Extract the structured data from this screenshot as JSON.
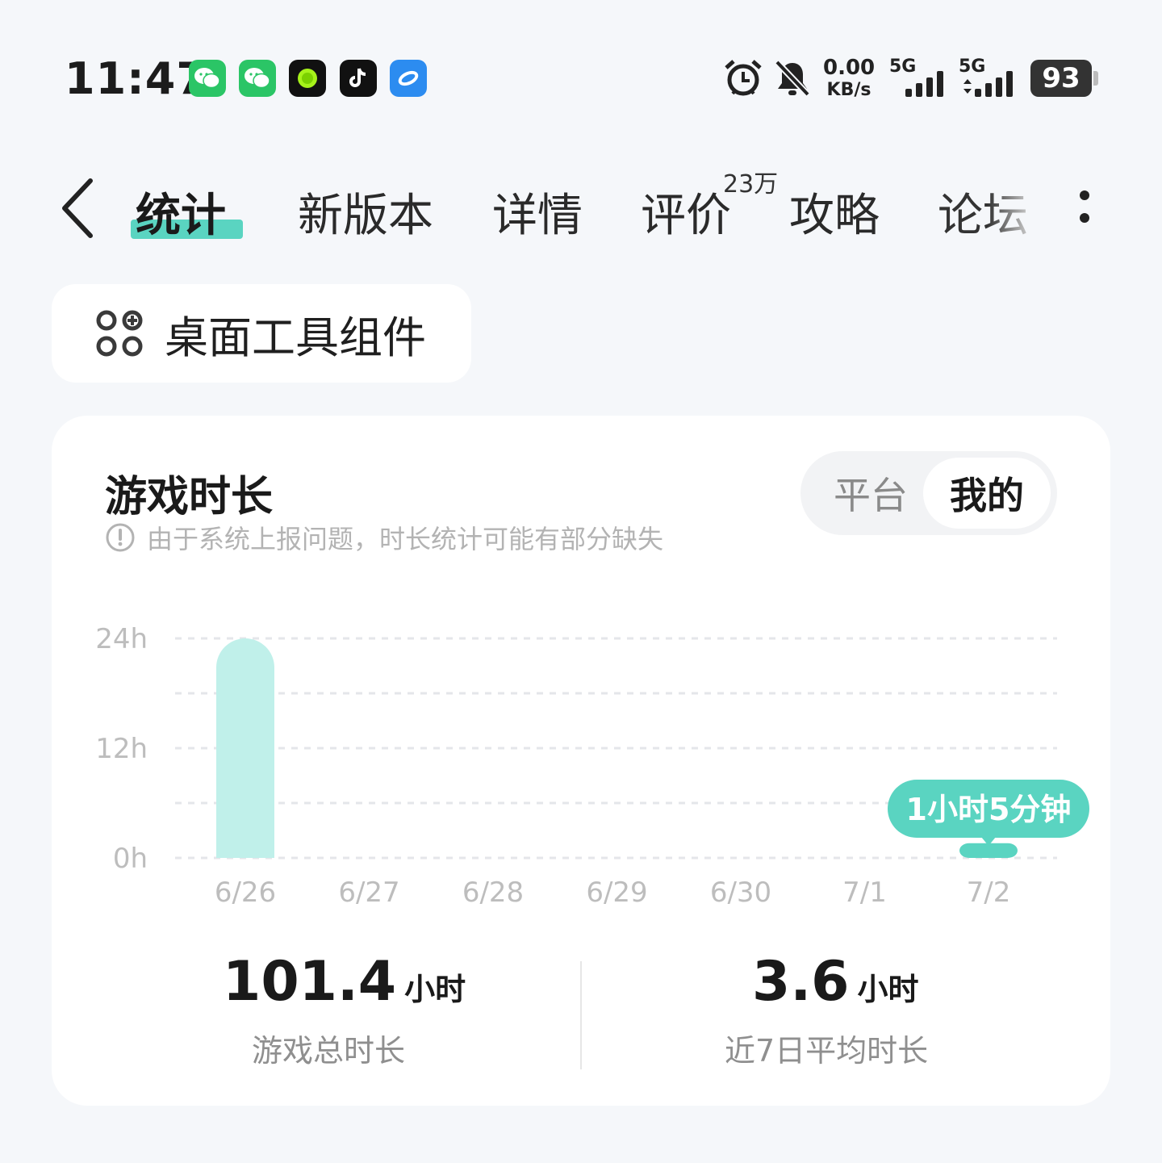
{
  "status_bar": {
    "time": "11:47",
    "notifications": [
      "wechat-icon",
      "wechat-icon",
      "green-dot-app-icon",
      "tiktok-icon",
      "blue-app-icon"
    ],
    "net_speed_value": "0.00",
    "net_speed_unit": "KB/s",
    "sim1_label": "5G",
    "sim2_label": "5G",
    "battery": "93"
  },
  "nav": {
    "tabs": [
      {
        "label": "统计",
        "active": true
      },
      {
        "label": "新版本"
      },
      {
        "label": "详情"
      },
      {
        "label": "评价",
        "badge": "23万"
      },
      {
        "label": "攻略"
      },
      {
        "label": "论坛"
      }
    ]
  },
  "widget_button": {
    "label": "桌面工具组件"
  },
  "card": {
    "title": "游戏时长",
    "notice": "由于系统上报问题，时长统计可能有部分缺失",
    "segments": [
      "平台",
      "我的"
    ],
    "selected_segment": "我的",
    "stats": [
      {
        "value": "101.4",
        "unit": "小时",
        "label": "游戏总时长"
      },
      {
        "value": "3.6",
        "unit": "小时",
        "label": "近7日平均时长"
      }
    ]
  },
  "chart_data": {
    "type": "bar",
    "categories": [
      "6/26",
      "6/27",
      "6/28",
      "6/29",
      "6/30",
      "7/1",
      "7/2"
    ],
    "values": [
      24,
      0,
      0,
      0,
      0,
      0,
      1.083
    ],
    "yticks": [
      "0h",
      "12h",
      "24h"
    ],
    "ylim": [
      0,
      24
    ],
    "bar_color": "#c0f0ea",
    "highlight_color": "#5ad4c1",
    "tooltip": {
      "category": "7/2",
      "text": "1小时5分钟"
    },
    "grid": true
  }
}
